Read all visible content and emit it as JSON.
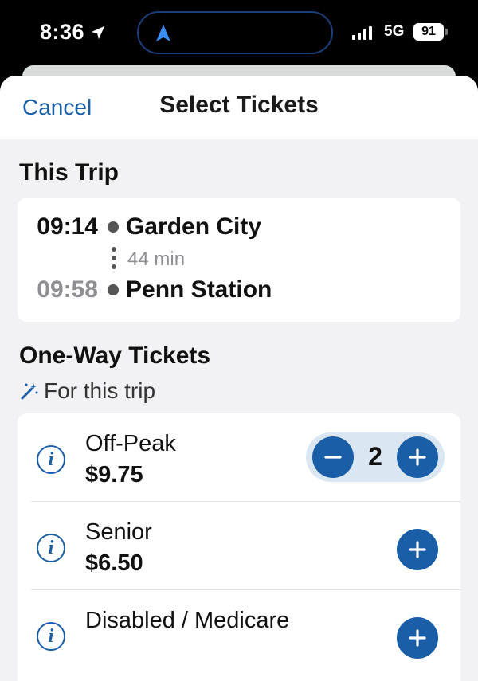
{
  "status_bar": {
    "time": "8:36",
    "network": "5G",
    "battery": "91"
  },
  "nav": {
    "cancel_label": "Cancel",
    "title": "Select Tickets"
  },
  "trip": {
    "section_title": "This Trip",
    "departure_time": "09:14",
    "departure_station": "Garden City",
    "duration": "44 min",
    "arrival_time": "09:58",
    "arrival_station": "Penn Station"
  },
  "tickets": {
    "section_title": "One-Way Tickets",
    "subtitle": "For this trip",
    "items": [
      {
        "name": "Off-Peak",
        "price": "$9.75",
        "quantity": "2"
      },
      {
        "name": "Senior",
        "price": "$6.50"
      },
      {
        "name": "Disabled / Medicare"
      }
    ]
  },
  "colors": {
    "accent": "#1a5ea8",
    "stepper_bg": "#dbe6f3",
    "sheet_bg": "#f2f2f4"
  },
  "icons": [
    "location-arrow-icon",
    "navigation-icon",
    "signal-icon",
    "battery-icon",
    "magic-wand-icon",
    "info-icon",
    "minus-icon",
    "plus-icon"
  ]
}
